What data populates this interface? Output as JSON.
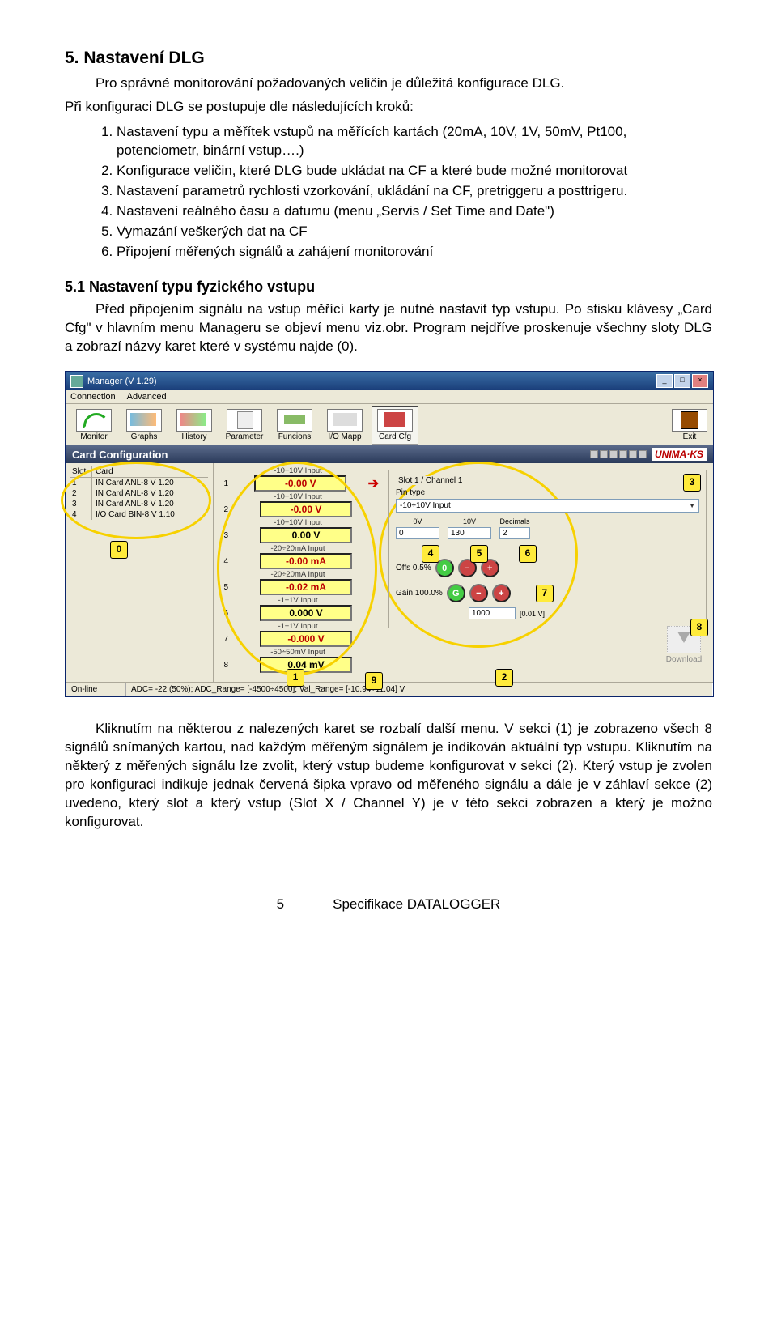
{
  "headings": {
    "h5": "5.  Nastavení DLG",
    "h51": "5.1  Nastavení typu fyzického vstupu"
  },
  "intro1": "Pro správné monitorování požadovaných veličin je důležitá konfigurace DLG.",
  "intro2": "Při konfiguraci DLG se postupuje dle následujících kroků:",
  "steps": [
    "Nastavení typu a měřítek vstupů na měřících kartách (20mA, 10V, 1V, 50mV, Pt100, potenciometr, binární vstup….)",
    "Konfigurace veličin, které DLG bude ukládat na CF a které bude možné monitorovat",
    "Nastavení parametrů rychlosti vzorkování, ukládání na CF, pretriggeru a posttrigeru.",
    "Nastavení reálného času a datumu (menu „Servis / Set Time and Date\")",
    "Vymazání veškerých dat na CF",
    "Připojení měřených signálů a zahájení monitorování"
  ],
  "para51": "Před připojením signálu na vstup měřící karty je nutné nastavit typ vstupu. Po stisku klávesy „Card Cfg\" v hlavním menu Manageru se objeví menu viz.obr. Program nejdříve proskenuje všechny sloty DLG a zobrazí názvy karet které v systému najde (0).",
  "paraEnd": "Kliknutím na některou z nalezených karet se rozbalí další menu. V sekci (1) je zobrazeno všech 8 signálů snímaných kartou, nad každým měřeným signálem je indikován aktuální typ vstupu. Kliknutím na některý z měřených signálu lze zvolit, který vstup budeme konfigurovat v sekci (2). Který vstup je zvolen pro konfiguraci indikuje jednak červená šipka vpravo od měřeného signálu a dále je v záhlaví sekce (2) uvedeno, který slot a který vstup (Slot X / Channel Y) je v této sekci zobrazen a který je možno konfigurovat.",
  "footer": {
    "page": "5",
    "doc": "Specifikace DATALOGGER"
  },
  "win": {
    "title": "Manager (V 1.29)",
    "menu": {
      "m1": "Connection",
      "m2": "Advanced"
    },
    "tools": [
      "Monitor",
      "Graphs",
      "History",
      "Parameter",
      "Funcions",
      "I/O Mapp",
      "Card Cfg"
    ],
    "exit": "Exit",
    "cc_title": "Card Configuration",
    "brand": "UNIMA·KS",
    "listhead": {
      "slot": "Slot",
      "card": "Card"
    },
    "cards": [
      {
        "slot": "1",
        "name": "IN Card ANL-8 V 1.20"
      },
      {
        "slot": "2",
        "name": "IN Card ANL-8 V 1.20"
      },
      {
        "slot": "3",
        "name": "IN Card ANL-8 V 1.20"
      },
      {
        "slot": "4",
        "name": "I/O Card BIN-8 V 1.10"
      }
    ],
    "readings": [
      {
        "n": "1",
        "lbl": "-10÷10V Input",
        "val": "-0.00 V",
        "red": true
      },
      {
        "n": "2",
        "lbl": "-10÷10V Input",
        "val": "-0.00 V",
        "red": true
      },
      {
        "n": "3",
        "lbl": "-10÷10V Input",
        "val": "0.00 V",
        "red": false
      },
      {
        "n": "4",
        "lbl": "-20÷20mA Input",
        "val": "-0.00 mA",
        "red": true
      },
      {
        "n": "5",
        "lbl": "-20÷20mA Input",
        "val": "-0.02 mA",
        "red": true
      },
      {
        "n": "6",
        "lbl": "-1÷1V Input",
        "val": "0.000 V",
        "red": false
      },
      {
        "n": "7",
        "lbl": "-1÷1V Input",
        "val": "-0.000 V",
        "red": true
      },
      {
        "n": "8",
        "lbl": "-50÷50mV Input",
        "val": "0.04 mV",
        "red": false
      }
    ],
    "slotch": "Slot 1 / Channel 1",
    "pintype_label": "Pin type",
    "pintype_val": "-10÷10V Input",
    "row3": {
      "c1l": "0V",
      "c1v": "0",
      "c2l": "10V",
      "c2v": "130",
      "c3l": "Decimals",
      "c3v": "2"
    },
    "offs_label": "Offs 0.5%",
    "gain_label": "Gain 100.0%",
    "gain_side": "G",
    "num_left": "1000",
    "num_right": "[0.01 V]",
    "download": "Download",
    "status_left": "On-line",
    "status_right": "ADC= -22 (50%); ADC_Range= [-4500÷4500]; Val_Range= [-10.94÷11.04] V"
  }
}
